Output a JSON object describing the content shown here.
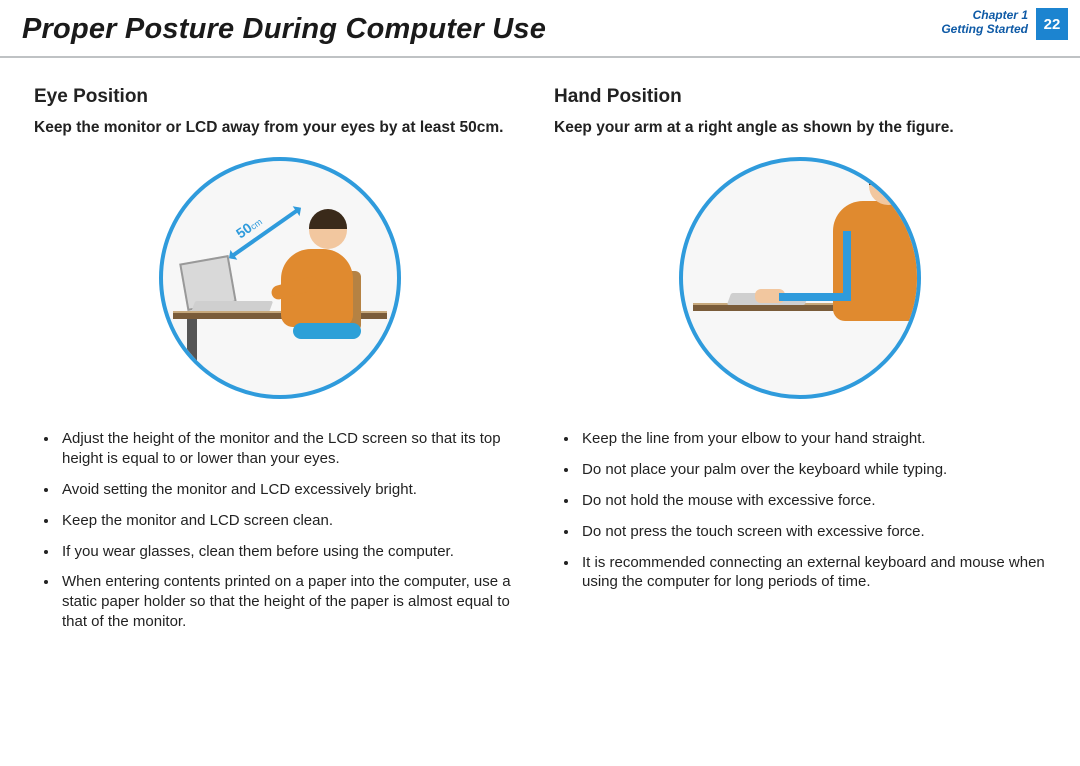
{
  "header": {
    "title": "Proper Posture During Computer Use",
    "chapter_line1": "Chapter 1",
    "chapter_line2": "Getting Started",
    "page_number": "22"
  },
  "left": {
    "heading": "Eye Position",
    "lead": "Keep the monitor or LCD away from your eyes by at least 50cm.",
    "figure_distance_value": "50",
    "figure_distance_unit": "cm",
    "bullets": [
      "Adjust the height of the monitor and the LCD screen so that its top height is equal to or lower than your eyes.",
      "Avoid setting the monitor and LCD excessively bright.",
      "Keep the monitor and LCD screen clean.",
      "If you wear glasses, clean them before using the computer.",
      "When entering contents printed on a paper into the computer, use a static paper holder so that the height of the paper is almost equal to that of the monitor."
    ]
  },
  "right": {
    "heading": "Hand Position",
    "lead": "Keep your arm at a right angle as shown by the figure.",
    "bullets": [
      "Keep the line from your elbow to your hand straight.",
      "Do not place your palm over the keyboard while typing.",
      "Do not hold the mouse with excessive force.",
      "Do not press the touch screen with excessive force.",
      "It is recommended connecting an external keyboard and mouse when using the computer for long periods of time."
    ]
  }
}
